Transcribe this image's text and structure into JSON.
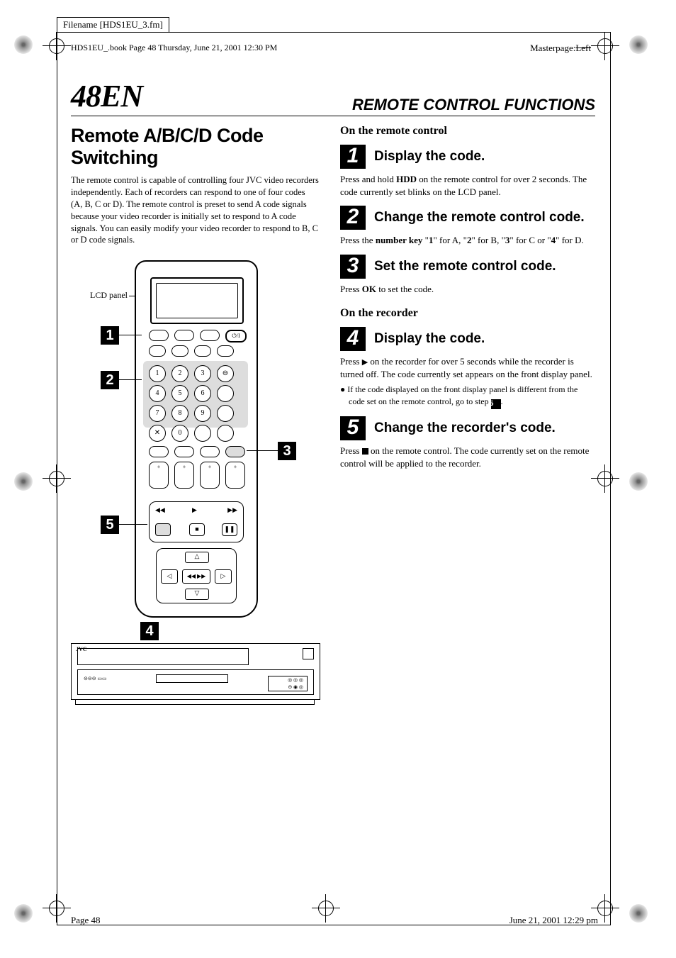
{
  "meta": {
    "filename_label": "Filename [HDS1EU_3.fm]",
    "book_line": "HDS1EU_.book  Page 48  Thursday, June 21, 2001  12:30 PM",
    "masterpage_prefix": "Masterpage:",
    "masterpage_struck": "Left"
  },
  "header": {
    "page_number": "48",
    "lang": "EN",
    "section": "REMOTE CONTROL FUNCTIONS"
  },
  "title": "Remote A/B/C/D Code Switching",
  "intro": "The remote control is capable of controlling four JVC video recorders independently. Each of recorders can respond to one of four codes (A, B, C or D). The remote control is preset to send A code signals because your video recorder is initially set to respond to A code signals. You can easily modify your video recorder to respond to B, C or D code signals.",
  "illustration": {
    "lcd_label": "LCD panel",
    "callouts": {
      "c1": "1",
      "c2": "2",
      "c3": "3",
      "c4": "4",
      "c5": "5"
    },
    "recorder_brand": "JVC"
  },
  "right": {
    "on_remote": "On the remote control",
    "step1": {
      "num": "1",
      "head": "Display the code.",
      "body_a": "Press and hold ",
      "body_b": "HDD",
      "body_c": " on the remote control for over 2 seconds. The code currently set blinks on the LCD panel."
    },
    "step2": {
      "num": "2",
      "head": "Change the remote control code.",
      "body_a": "Press the  ",
      "body_b": "number key",
      "body_c": " \"",
      "k1": "1",
      "body_d": "\" for A, \"",
      "k2": "2",
      "body_e": "\" for B, \"",
      "k3": "3",
      "body_f": "\" for C or \"",
      "k4": "4",
      "body_g": "\" for D."
    },
    "step3": {
      "num": "3",
      "head": "Set the remote control code.",
      "body_a": "Press ",
      "body_b": "OK",
      "body_c": " to set the code."
    },
    "on_recorder": "On the recorder",
    "step4": {
      "num": "4",
      "head": "Display the code.",
      "body_a": "Press ",
      "body_b": " on the recorder for over 5 seconds while the recorder is turned off. The code currently set appears on the front display panel.",
      "bullet_a": "If the code displayed on the front display panel is different from the code set on the remote control, go to step ",
      "bullet_ref": "5",
      "bullet_b": "."
    },
    "step5": {
      "num": "5",
      "head": "Change the recorder's code.",
      "body_a": "Press ",
      "body_b": " on the remote control. The code currently set on the remote control will be applied to the recorder."
    }
  },
  "footer": {
    "left": "Page 48",
    "right": "June 21, 2001 12:29 pm"
  }
}
